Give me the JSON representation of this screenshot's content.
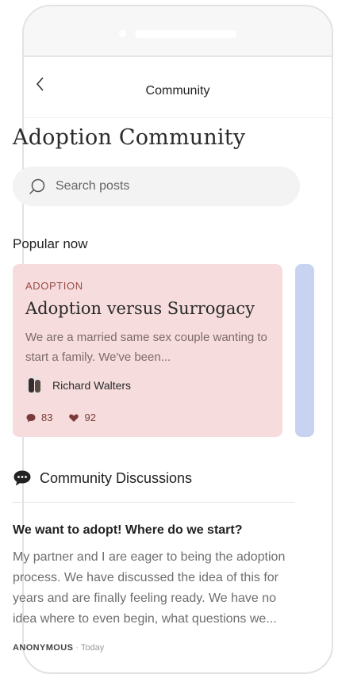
{
  "nav": {
    "back_glyph": "<",
    "title": "Community"
  },
  "page": {
    "title": "Adoption Community"
  },
  "search": {
    "placeholder": "Search posts",
    "value": ""
  },
  "popular": {
    "label": "Popular now",
    "cards": [
      {
        "tag": "ADOPTION",
        "title": "Adoption versus Surrogacy",
        "body": "We are a married same sex couple wanting to start a family. We've been...",
        "author": "Richard Walters",
        "comments": "83",
        "likes": "92",
        "color": "#f6dcdc"
      }
    ],
    "peek_color": "#c7d3f0"
  },
  "discussions": {
    "title": "Community Discussions",
    "posts": [
      {
        "title": "We want to adopt! Where do we start?",
        "body": "My partner and I are eager to being the adoption process. We have discussed the idea of this for years and are finally feeling ready. We have no idea where to even begin, what questions we...",
        "author": "ANONYMOUS",
        "separator": " · ",
        "time": "Today"
      }
    ]
  },
  "icons": {
    "back": "chevron-left-icon",
    "search": "search-icon",
    "comment": "comment-icon",
    "like": "heart-icon",
    "discussions": "chat-bubble-icon"
  },
  "colors": {
    "accent": "#9a4c4c",
    "card_bg": "#f6dcdc",
    "text_muted": "#6e6e6e"
  }
}
